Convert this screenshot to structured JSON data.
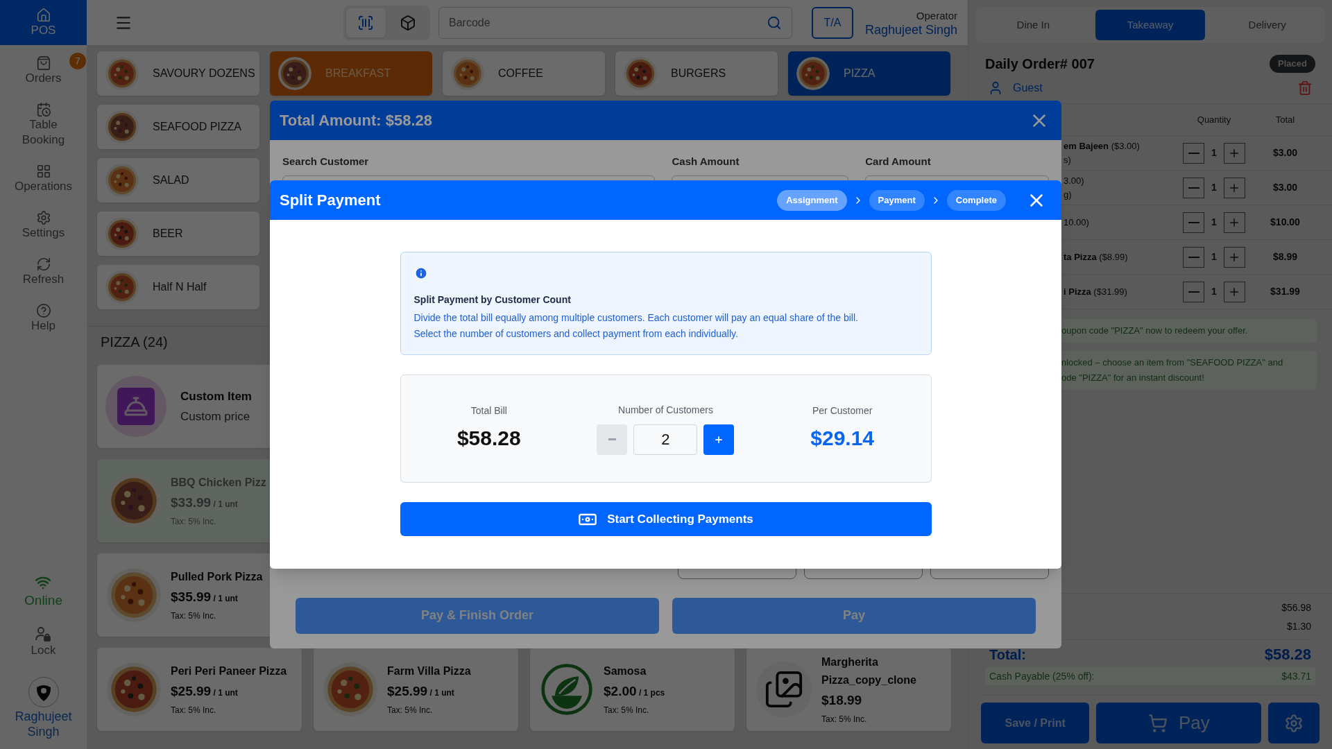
{
  "sidebar": {
    "items": [
      {
        "label": "POS",
        "selected": true
      },
      {
        "label": "Orders",
        "selected": false,
        "badge": "7"
      },
      {
        "label": "Table Booking",
        "selected": false
      },
      {
        "label": "Operations",
        "selected": false
      },
      {
        "label": "Settings",
        "selected": false
      },
      {
        "label": "Refresh",
        "selected": false
      },
      {
        "label": "Help",
        "selected": false
      }
    ],
    "status": {
      "label": "Online",
      "online": true
    },
    "lock": "Lock",
    "user": "Raghujeet Singh"
  },
  "header": {
    "scan_modes": [
      {
        "kind": "barcode",
        "selected": true
      },
      {
        "kind": "box",
        "selected": false
      }
    ],
    "search": {
      "placeholder": "Barcode"
    },
    "ta_button": "T/A",
    "operator_label": "Operator",
    "operator_name": "Raghujeet Singh"
  },
  "categories": [
    {
      "label": "SAVOURY DOZENS",
      "selected": false,
      "kind": "plain"
    },
    {
      "label": "BREAKFAST",
      "selected": false,
      "kind": "featured"
    },
    {
      "label": "COFFEE",
      "selected": false,
      "kind": "plain"
    },
    {
      "label": "BURGERS",
      "selected": false,
      "kind": "plain"
    },
    {
      "label": "PIZZA",
      "selected": true,
      "kind": "plain"
    },
    {
      "label": "SEAFOOD PIZZA",
      "selected": false,
      "kind": "plain"
    },
    {
      "label": "SALAD",
      "selected": false,
      "kind": "plain"
    },
    {
      "label": "BEER",
      "selected": false,
      "kind": "plain"
    },
    {
      "label": "Half N Half",
      "selected": false,
      "kind": "plain"
    }
  ],
  "section": {
    "title": "PIZZA (24)"
  },
  "products": [
    {
      "kind": "custom",
      "name": "Custom Item",
      "subtitle": "Custom price"
    },
    {
      "kind": "picture",
      "name": "BBQ Chicken Pizz",
      "price": "$33.99",
      "unit": "/ 1 unt",
      "tax": "Tax: 5% Inc.",
      "disabled": true
    },
    {
      "kind": "picture",
      "name": "Pulled Pork Pizza",
      "price": "$35.99",
      "unit": "/ 1 unt",
      "tax": "Tax: 5% Inc.",
      "disabled": false
    },
    {
      "kind": "picture",
      "name": "Peri Peri Paneer Pizza",
      "price": "$25.99",
      "unit": "/ 1 unt",
      "tax": "Tax: 5% Inc.",
      "disabled": false
    },
    {
      "kind": "picture",
      "name": "Farm Villa Pizza",
      "price": "$25.99",
      "unit": "/ 1 unt",
      "tax": "Tax: 5% Inc.",
      "disabled": false
    },
    {
      "kind": "picture",
      "name": "Samosa",
      "price": "$2.00",
      "unit": "/ 1 pcs",
      "tax": "Tax: 5% Inc.",
      "disabled": false
    },
    {
      "kind": "placeholder",
      "name": "Margherita Pizza_copy_clone",
      "price": "$18.99",
      "tax": "Tax: 5% Inc.",
      "disabled": false
    }
  ],
  "order_panel": {
    "tabs": [
      {
        "label": "Dine In",
        "selected": false
      },
      {
        "label": "Takeaway",
        "selected": true
      },
      {
        "label": "Delivery",
        "selected": false
      }
    ],
    "title": "Daily Order# 007",
    "status": "Placed",
    "customer": "Guest",
    "columns": [
      "Quantity",
      "Total"
    ],
    "items": [
      {
        "name": "**em Bajeen** ($3.00)",
        "note": "s)",
        "quantity": "1",
        "total": "$3.00"
      },
      {
        "name": "3.00)",
        "note": "g)",
        "quantity": "1",
        "total": "$3.00"
      },
      {
        "name": "10.00)",
        "quantity": "1",
        "total": "$10.00"
      },
      {
        "name": "**ta Pizza** ($8.99)",
        "quantity": "1",
        "total": "$8.99"
      },
      {
        "name": "**i Pizza** ($31.99)",
        "quantity": "1",
        "total": "$31.99"
      }
    ],
    "promos": [
      {
        "lines": [
          "oupon code \"PIZZA\" now to redeem your offer."
        ]
      },
      {
        "lines": [
          "nlocked – choose an item from \"SEAFOOD PIZZA\" and",
          "ode \"PIZZA\" for an instant discount!"
        ]
      }
    ],
    "summary": {
      "subtotal": "$56.98",
      "tax": "$1.30",
      "total_label": "Total:",
      "total": "$58.28",
      "cash_label": "Cash Payable (25% off):",
      "cash": "$43.71"
    },
    "save_button": "Save / Print",
    "pay_button": "Pay"
  },
  "payment_modal": {
    "title": "Total Amount: $58.28",
    "fields": [
      {
        "label": "Search Customer"
      },
      {
        "label": "Cash Amount"
      },
      {
        "label": "Card Amount"
      }
    ],
    "buttons": [
      "Pay & Finish Order",
      "Pay"
    ]
  },
  "split_modal": {
    "title": "Split Payment",
    "steps": [
      {
        "label": "Assignment",
        "selected": true
      },
      {
        "label": "Payment",
        "selected": false
      },
      {
        "label": "Complete",
        "selected": false
      }
    ],
    "info": {
      "title": "Split Payment by Customer Count",
      "lines": [
        "Divide the total bill equally among multiple customers. Each customer will pay an equal share of the bill.",
        "Select the number of customers and collect payment from each individually."
      ]
    },
    "total_label": "Total Bill",
    "total": "$58.28",
    "count_label": "Number of Customers",
    "count": "2",
    "decrement_disabled": true,
    "per_label": "Per Customer",
    "per": "$29.14",
    "action": "Start Collecting Payments"
  }
}
